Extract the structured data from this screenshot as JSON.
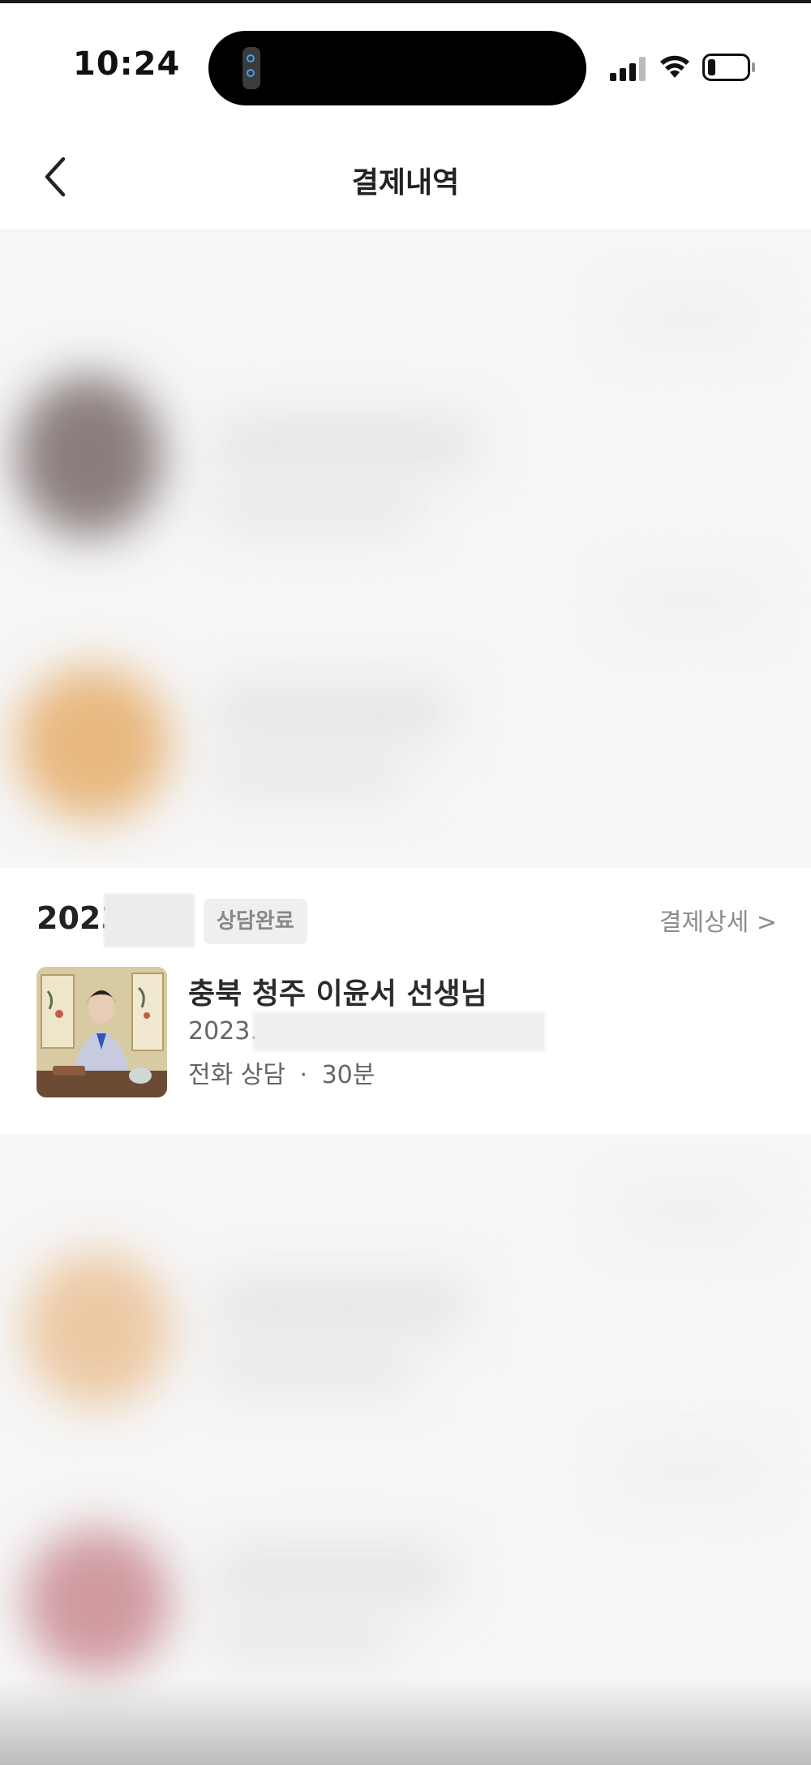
{
  "status_bar": {
    "time": "10:24"
  },
  "header": {
    "title": "결제내역",
    "back_icon": "chevron-left-icon"
  },
  "history_card": {
    "date_prefix": "2023",
    "status_badge": "상담완료",
    "detail_link": "결제상세 >",
    "counselor_name": "충북 청주 이윤서 선생님",
    "date_text": "2023.",
    "service_type": "전화 상담",
    "separator": "·",
    "duration": "30분"
  },
  "colors": {
    "background": "#f7f7f7",
    "card": "#ffffff",
    "badge_bg": "#efefef",
    "muted_text": "#8d8d8d"
  }
}
